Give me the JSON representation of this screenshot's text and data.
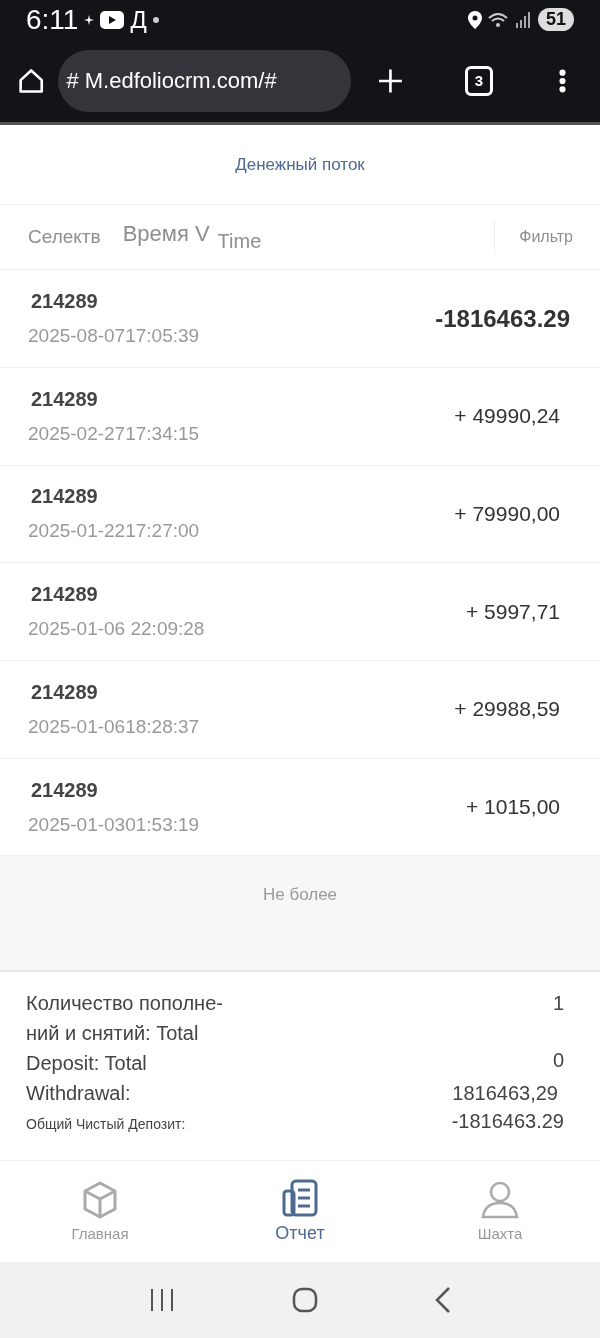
{
  "status_bar": {
    "time": "6:11",
    "notification_text": "Д",
    "battery": "51"
  },
  "browser": {
    "url": "# M.edfoliocrm.com/#",
    "tab_count": "3"
  },
  "page_title": "Денежный поток",
  "filter_bar": {
    "select_label": "Селектв",
    "sort_label": "Время V",
    "sort_overlay": "Time",
    "filter_label": "Фильтр"
  },
  "transactions": [
    {
      "id": "214289",
      "datetime": "2025-08-0717:05:39",
      "amount": "-1816463.29",
      "emphasized": true
    },
    {
      "id": "214289",
      "datetime": "2025-02-2717:34:15",
      "amount": "+ 49990,24",
      "emphasized": false
    },
    {
      "id": "214289",
      "datetime": "2025-01-2217:27:00",
      "amount": "+ 79990,00",
      "emphasized": false
    },
    {
      "id": "214289",
      "datetime": "2025-01-06 22:09:28",
      "amount": "+ 5997,71",
      "emphasized": false
    },
    {
      "id": "214289",
      "datetime": "2025-01-0618:28:37",
      "amount": "+ 29988,59",
      "emphasized": false
    },
    {
      "id": "214289",
      "datetime": "2025-01-0301:53:19",
      "amount": "+ 1015,00",
      "emphasized": false
    }
  ],
  "list_end": "Не более",
  "summary": {
    "label_lines": [
      "Количество пополне-",
      "ний и снятий: Total",
      "Deposit: Total",
      "Withdrawal:"
    ],
    "values": [
      "1",
      "0",
      "1816463,29"
    ],
    "net_label": "Общий Чистый Депозит:",
    "net_value": "-1816463.29"
  },
  "bottom_nav": [
    {
      "label": "Главная",
      "selected": false
    },
    {
      "label": "Отчет",
      "selected": true
    },
    {
      "label": "Шахта",
      "selected": false
    }
  ]
}
